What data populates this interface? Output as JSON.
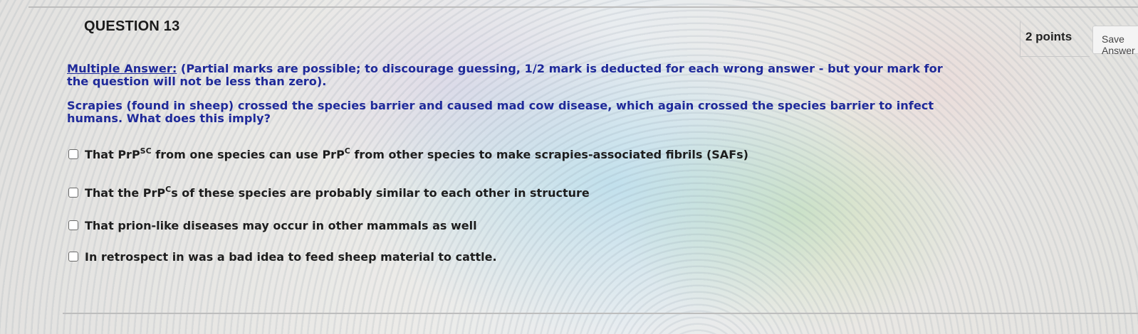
{
  "question": {
    "title": "QUESTION 13",
    "points": "2 points",
    "save_label": "Save Answer",
    "instruction_lead": "Multiple Answer:",
    "instruction_rest": " (Partial marks are possible; to discourage guessing, 1/2 mark is deducted for each wrong answer - but your mark for the question will not be less than zero).",
    "prompt": "Scrapies (found in sheep) crossed the species barrier and caused mad cow disease, which again crossed the species barrier to infect humans. What does this imply?"
  },
  "options": [
    {
      "a": "That PrP",
      "sup1": "SC",
      "b": " from one species can use PrP",
      "sup2": "C",
      "c": " from other species to make scrapies-associated fibrils (SAFs)"
    },
    {
      "a": "That the PrP",
      "sup1": "C",
      "b": "s of these species are probably similar to each other in structure"
    },
    {
      "a": "That prion-like diseases may occur in other mammals as well"
    },
    {
      "a": "In retrospect in was a bad idea to feed sheep material to cattle."
    }
  ],
  "colors": {
    "instruction_text": "#1f2a9a",
    "option_text": "#1d1d1d"
  }
}
